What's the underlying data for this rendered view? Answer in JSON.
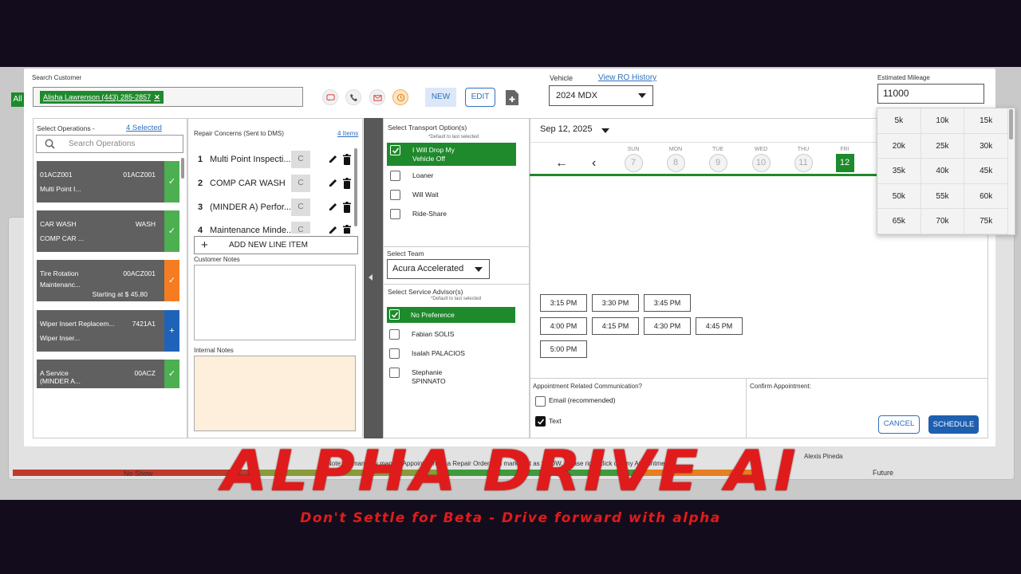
{
  "background": {
    "all_tab": "All",
    "note": "Note: To manually map an Appointment to a Repair Order and marking it as SHOW, please right-click on any Appointment.",
    "no_show": "No Show",
    "advisor_name": "Alexis Pineda",
    "future": "Future",
    "bar_colors": [
      "#c0392b",
      "#8a9b3a",
      "#3f9a3c",
      "#e67e22"
    ]
  },
  "header": {
    "search_label": "Search Customer",
    "customer_chip": "Alisha Lawrenson (443) 285-2857",
    "new_label": "NEW",
    "edit_label": "EDIT",
    "vehicle_label": "Vehicle",
    "view_ro_history": "View RO History",
    "vehicle_value": "2024 MDX",
    "mileage_label": "Estimated Mileage",
    "mileage_value": "11000"
  },
  "mileage_options": [
    "5k",
    "10k",
    "15k",
    "20k",
    "25k",
    "30k",
    "35k",
    "40k",
    "45k",
    "50k",
    "55k",
    "60k",
    "65k",
    "70k",
    "75k"
  ],
  "operations": {
    "title": "Select Operations -",
    "selected": "4 Selected",
    "search_placeholder": "Search Operations",
    "items": [
      {
        "name": "01ACZ001",
        "code": "01ACZ001",
        "desc": "Multi Point I...",
        "price": "",
        "tag": "✓",
        "color": "#4caf50"
      },
      {
        "name": "CAR WASH",
        "code": "WASH",
        "desc": "COMP CAR ...",
        "price": "",
        "tag": "✓",
        "color": "#4caf50"
      },
      {
        "name": "Tire Rotation",
        "code": "00ACZ001",
        "desc": "Maintenanc...",
        "price": "Starting at $ 45.80",
        "tag": "✓",
        "color": "#f57c20"
      },
      {
        "name": "Wiper Insert Replacem...",
        "code": "7421A1",
        "desc": "Wiper Inser...",
        "price": "",
        "tag": "+",
        "color": "#1f63b8"
      },
      {
        "name": "A Service",
        "code": "00ACZ",
        "desc": "(MINDER A...",
        "price": "",
        "tag": "✓",
        "color": "#4caf50"
      }
    ]
  },
  "concerns": {
    "title": "Repair Concerns (Sent to DMS)",
    "count": "4 Items",
    "items": [
      {
        "num": "1",
        "text": "Multi Point Inspecti...",
        "code": "C"
      },
      {
        "num": "2",
        "text": "COMP CAR WASH",
        "code": "C"
      },
      {
        "num": "3",
        "text": "(MINDER A) Perfor...",
        "code": "C"
      },
      {
        "num": "4",
        "text": "Maintenance Minde...",
        "code": "C"
      }
    ],
    "add_line": "ADD NEW LINE ITEM",
    "customer_notes_label": "Customer Notes",
    "internal_notes_label": "Internal Notes"
  },
  "transport": {
    "title": "Select Transport Option(s)",
    "hint": "*Default to last selected",
    "options": [
      "I Will Drop My",
      "Vehicle Off",
      "Loaner",
      "Will Wait",
      "Ride-Share"
    ],
    "team_label": "Select Team",
    "team_value": "Acura Accelerated",
    "advisor_title": "Select Service Advisor(s)",
    "advisor_hint": "*Default to last selected",
    "advisors": [
      "No Preference",
      "Fabian SOLIS",
      "Isalah PALACIOS",
      "Stephanie",
      "SPINNATO"
    ]
  },
  "schedule": {
    "date": "Sep 12, 2025",
    "days": [
      {
        "dn": "SUN",
        "dc": "7"
      },
      {
        "dn": "MON",
        "dc": "8"
      },
      {
        "dn": "TUE",
        "dc": "9"
      },
      {
        "dn": "WED",
        "dc": "10"
      },
      {
        "dn": "THU",
        "dc": "11"
      },
      {
        "dn": "FRI",
        "dc": "12"
      }
    ],
    "slots": [
      "3:15 PM",
      "3:30 PM",
      "3:45 PM",
      "4:00 PM",
      "4:15 PM",
      "4:30 PM",
      "4:45 PM",
      "5:00 PM"
    ],
    "comm_label": "Appointment Related Communication?",
    "email_label": "Email (recommended)",
    "text_label": "Text",
    "confirm_label": "Confirm Appointment:",
    "cancel": "CANCEL",
    "schedule": "SCHEDULE"
  },
  "branding": {
    "title": "ALPHA DRIVE AI",
    "tagline": "Don't Settle for Beta - Drive forward with alpha"
  }
}
